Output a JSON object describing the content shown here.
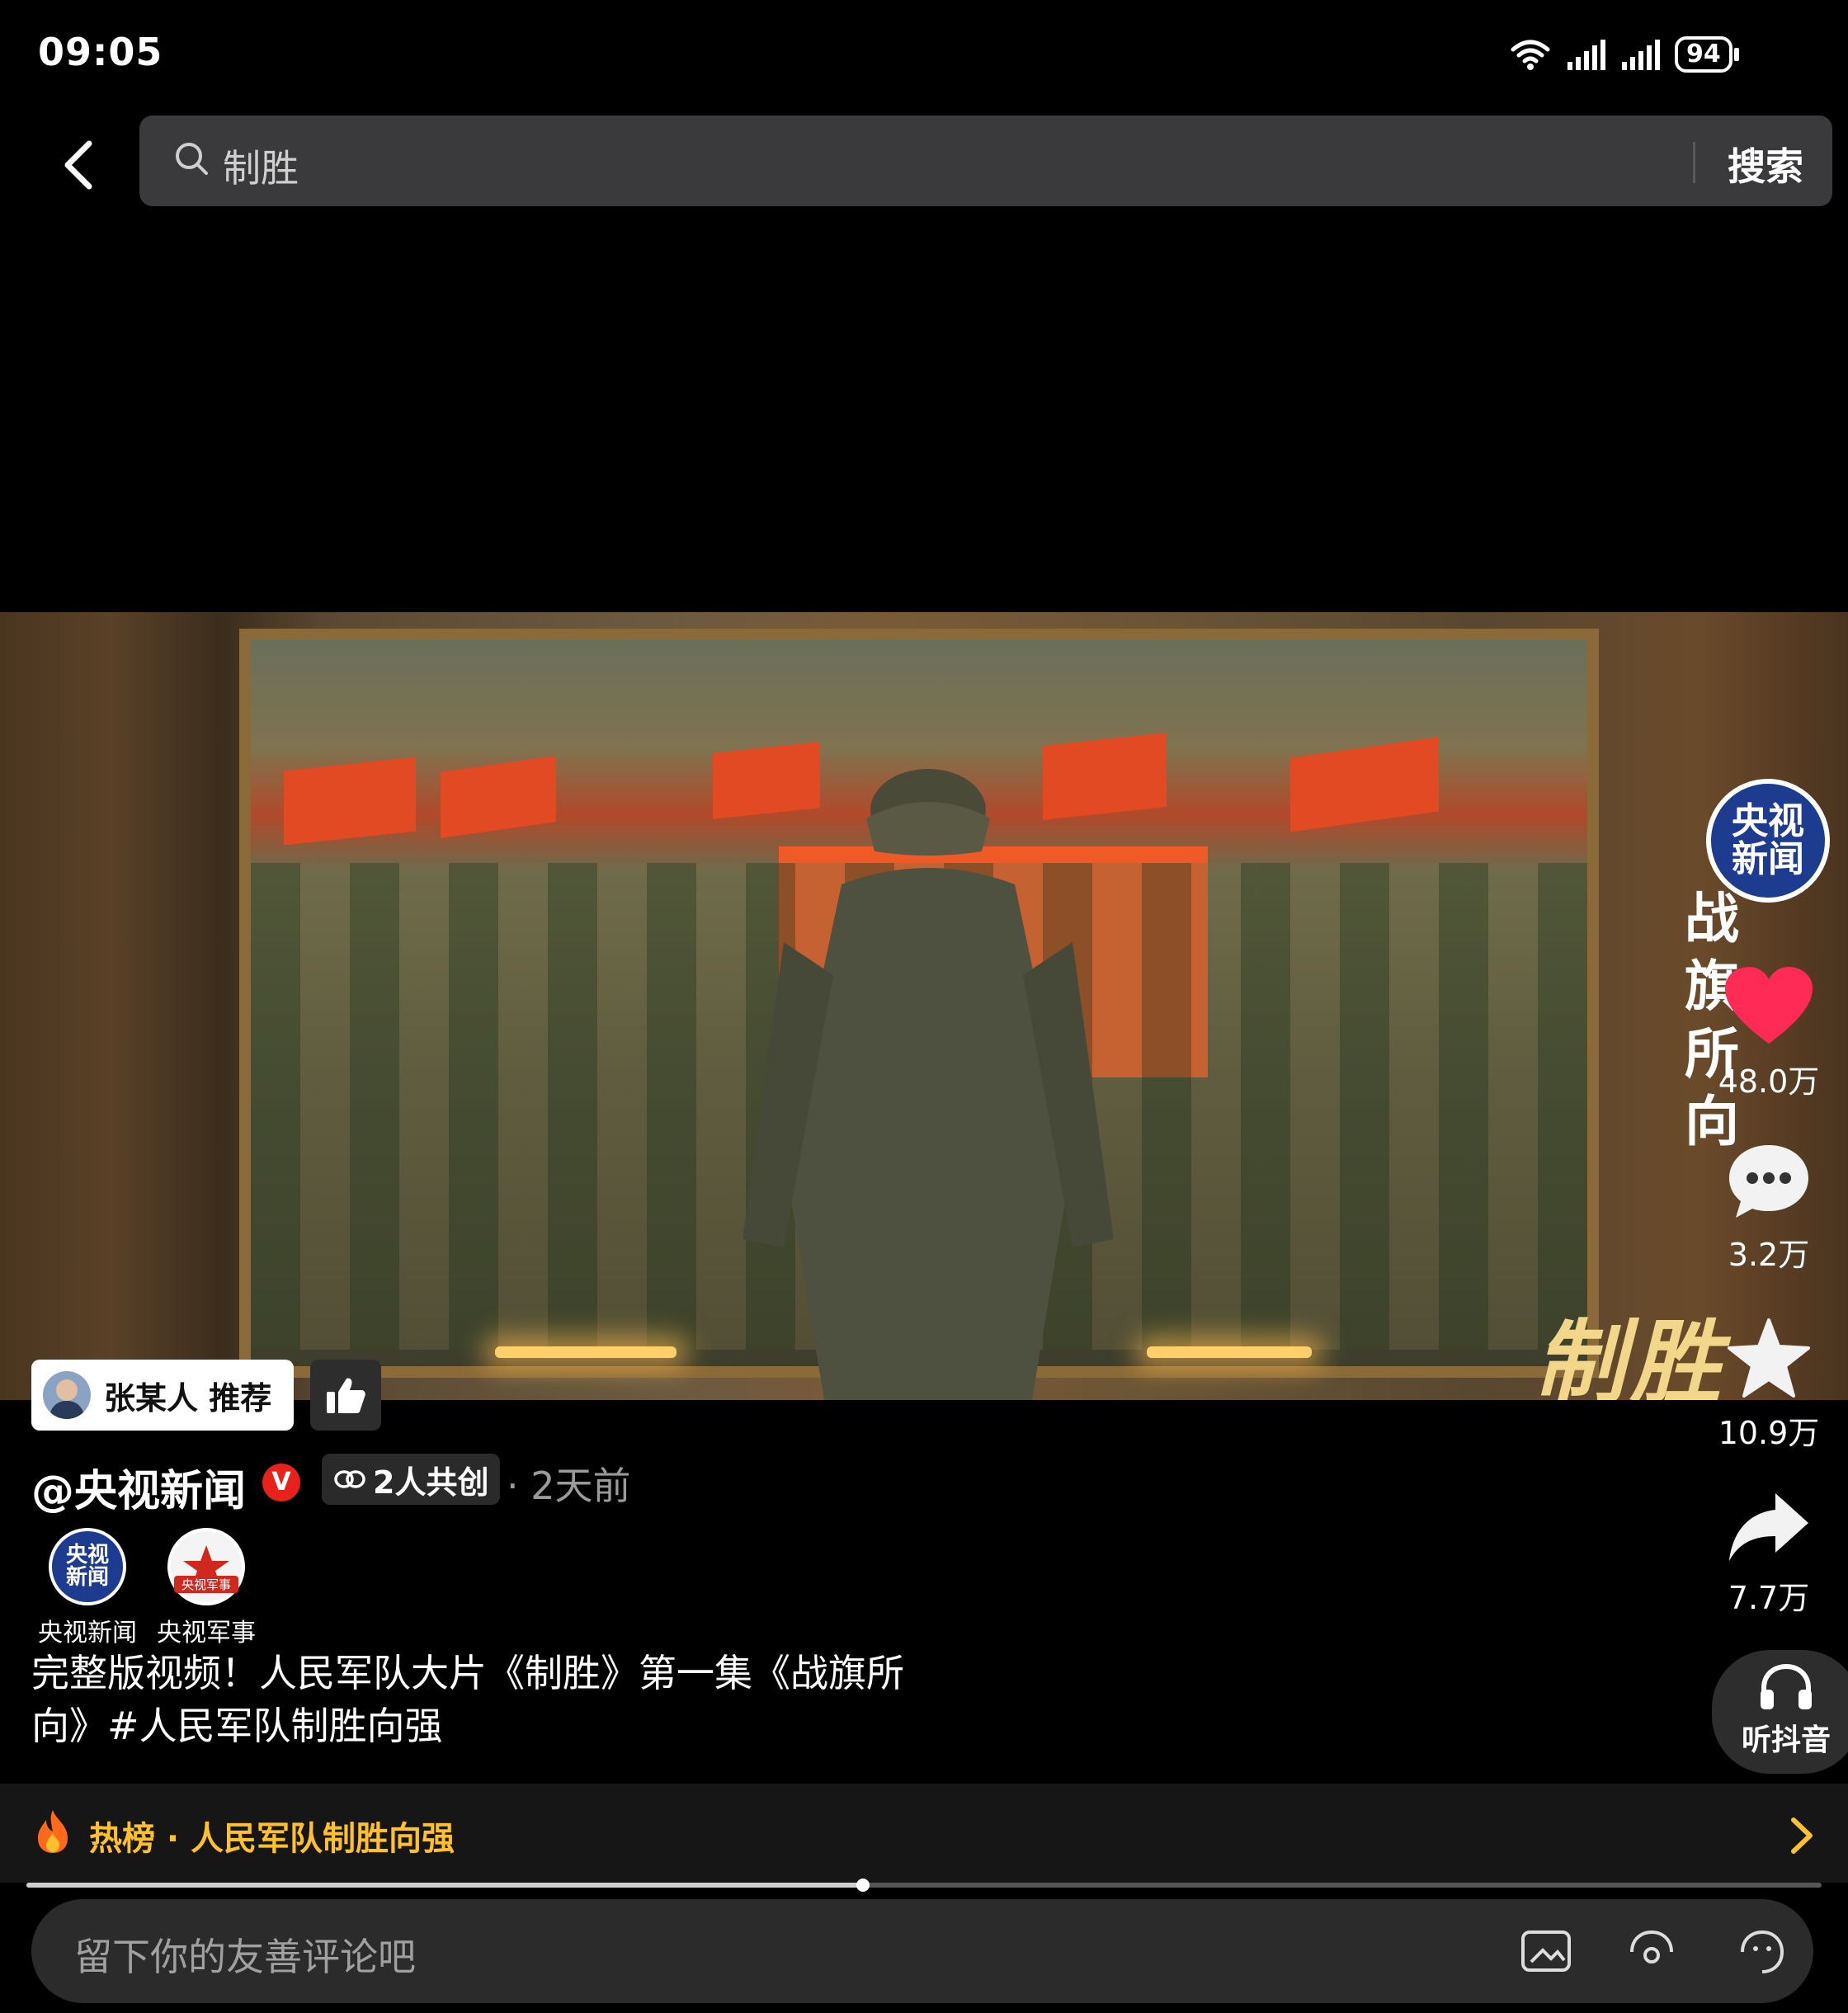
{
  "status_bar": {
    "time": "09:05",
    "battery": "94",
    "icons": [
      "wifi-icon",
      "signal-icon",
      "signal-icon",
      "battery-icon"
    ]
  },
  "top_bar": {
    "back_icon": "chevron-left-icon",
    "search_query": "制胜",
    "search_button": "搜索",
    "search_icon": "search-icon"
  },
  "video": {
    "vertical_watermark": [
      "战",
      "旗",
      "所",
      "向"
    ],
    "title_watermark": "制胜"
  },
  "actions": {
    "author_logo": [
      "央视",
      "新闻"
    ],
    "like_count": "48.0万",
    "comment_count": "3.2万",
    "favorite_count": "10.9万",
    "share_count": "7.7万",
    "listen_label": "听抖音"
  },
  "recommend": {
    "label": "张某人 推荐"
  },
  "post": {
    "author": "@央视新闻",
    "verified_mark": "V",
    "cocreate": "2人共创",
    "time_ago": "· 2天前",
    "creators": [
      {
        "name": "央视新闻",
        "logo": [
          "央视",
          "新闻"
        ],
        "color": "#1d3b8f"
      },
      {
        "name": "央视军事",
        "logo": [
          "央视军事"
        ],
        "color": "#d0281e"
      }
    ],
    "caption": "完整版视频！人民军队大片《制胜》第一集《战旗所向》#人民军队制胜向强"
  },
  "hot": {
    "label": "热榜 · 人民军队制胜向强",
    "accent": "#ffc12b"
  },
  "playback": {
    "progress": 0.466
  },
  "comment": {
    "placeholder": "留下你的友善评论吧"
  },
  "colors": {
    "like": "#ff2a55",
    "verified": "#e8211a",
    "brand_blue": "#1d3b8f"
  }
}
